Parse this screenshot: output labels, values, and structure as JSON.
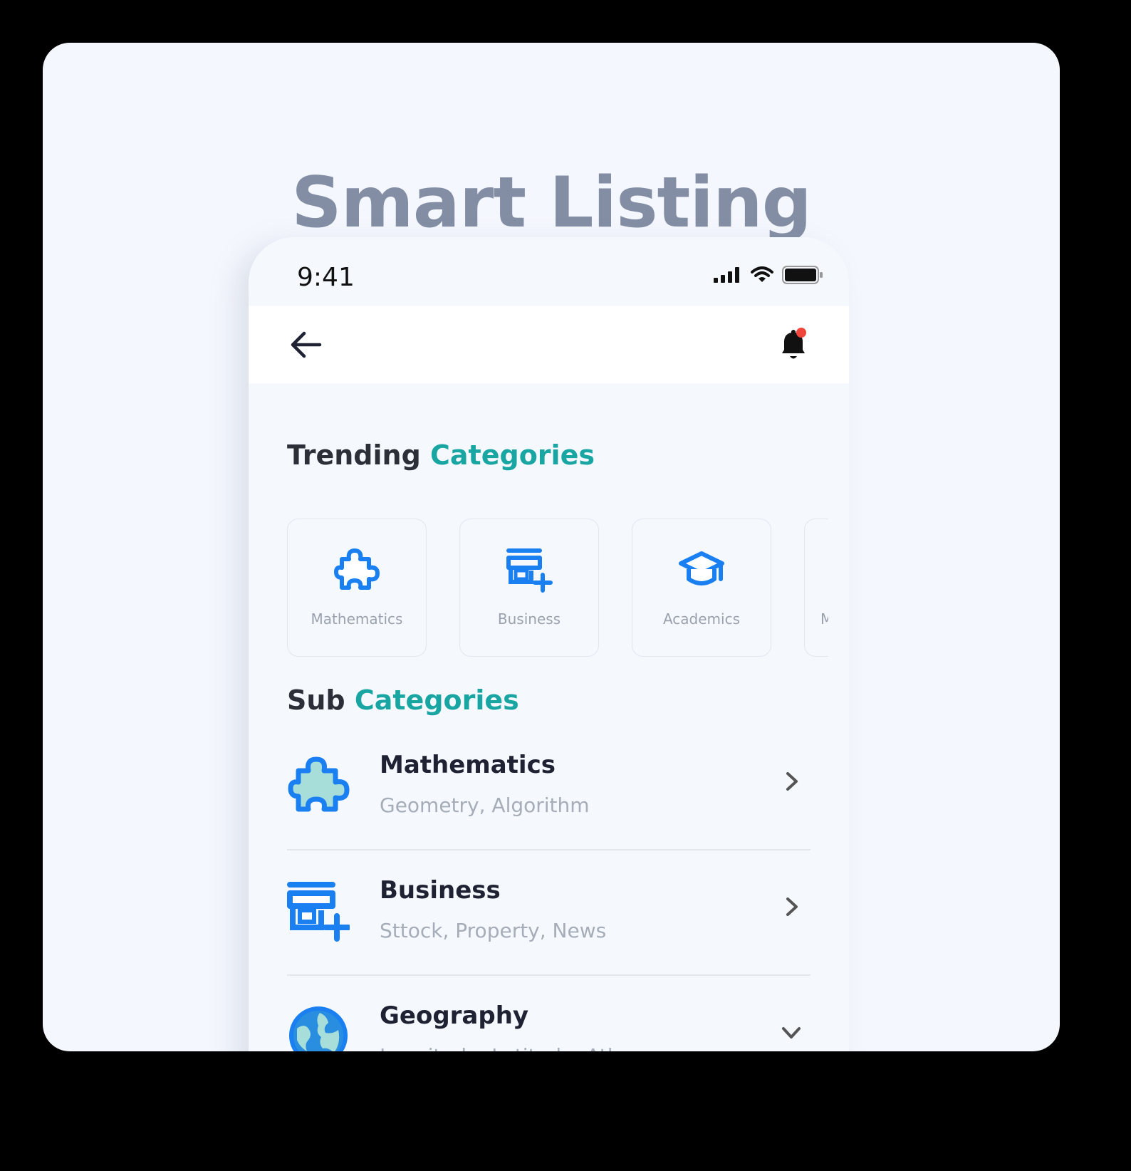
{
  "title": "Smart Listing",
  "status_bar": {
    "time": "9:41"
  },
  "trending": {
    "heading_plain": "Trending",
    "heading_accent": "Categories",
    "items": [
      {
        "label": "Mathematics",
        "icon": "puzzle-icon"
      },
      {
        "label": "Business",
        "icon": "store-add-icon"
      },
      {
        "label": "Academics",
        "icon": "graduation-cap-icon"
      },
      {
        "label": "M",
        "icon": ""
      }
    ]
  },
  "sub": {
    "heading_plain": "Sub",
    "heading_accent": "Categories",
    "items": [
      {
        "name": "Mathematics",
        "desc": "Geometry, Algorithm",
        "icon": "puzzle-icon",
        "chevron": "chevron-right-icon"
      },
      {
        "name": "Business",
        "desc": "Sttock, Property, News",
        "icon": "store-add-icon",
        "chevron": "chevron-right-icon"
      },
      {
        "name": "Geography",
        "desc": "Longitude, Latitude, Atlas",
        "icon": "globe-icon",
        "chevron": "chevron-down-icon"
      }
    ]
  },
  "colors": {
    "accent": "#19a6a3",
    "icon_blue": "#1a7ff0",
    "icon_fill_light": "#a8ded9",
    "title": "#838ea4",
    "notification_dot": "#f0453a"
  }
}
